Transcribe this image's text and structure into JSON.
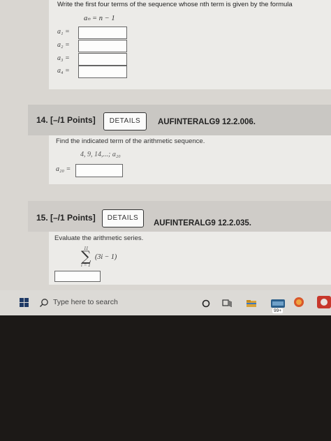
{
  "problem13": {
    "instruction": "Write the first four terms of the sequence whose nth term is given by the formula",
    "formula": "aₙ = n − 1",
    "labels": [
      "a₁ =",
      "a₂ =",
      "a₃ =",
      "a₄ ="
    ]
  },
  "problem14": {
    "points": "14.  [–/1 Points]",
    "details_label": "DETAILS",
    "code": "AUFINTERALG9 12.2.006.",
    "instruction": "Find the indicated term of the arithmetic sequence.",
    "sequence": "4, 9, 14,...; a₂₀",
    "answer_label": "a₂₀ ="
  },
  "problem15": {
    "points": "15.  [–/1 Points]",
    "details_label": "DETAILS",
    "code": "AUFINTERALG9 12.2.035.",
    "instruction": "Evaluate the arithmetic series.",
    "sum_upper": "11",
    "sum_symbol": "∑",
    "sum_expression": "(3i − 1)",
    "sum_lower": "i = 1"
  },
  "taskbar": {
    "search_placeholder": "Type here to search",
    "weather_badge": "99+"
  }
}
